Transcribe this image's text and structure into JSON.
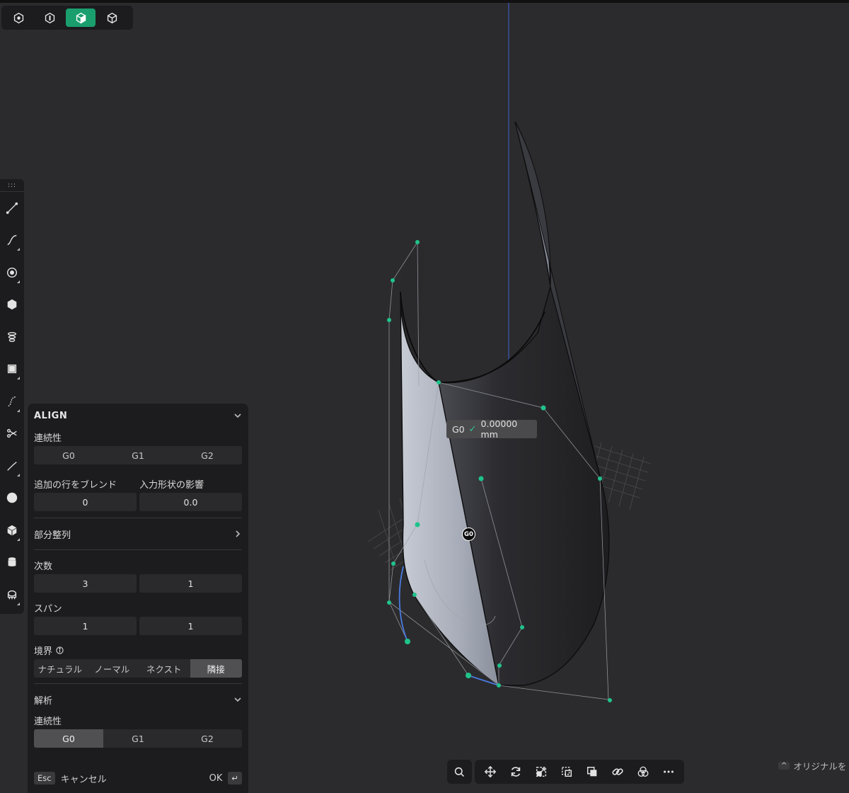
{
  "view_toolbar": {
    "buttons": [
      {
        "icon": "hexagon-dot-icon"
      },
      {
        "icon": "half-cube-icon"
      },
      {
        "icon": "shaded-cube-icon",
        "active": true
      },
      {
        "icon": "wire-cube-icon"
      }
    ]
  },
  "tool_strip": {
    "grip": ":::",
    "tools": [
      {
        "icon": "line-tool-icon"
      },
      {
        "icon": "curve-tool-icon",
        "has_flyout": true
      },
      {
        "icon": "circle-tool-icon",
        "has_flyout": true
      },
      {
        "icon": "polygon-tool-icon"
      },
      {
        "icon": "loft-tool-icon"
      },
      {
        "icon": "surface-frame-icon",
        "has_flyout": true
      },
      {
        "icon": "edit-curve-icon",
        "has_flyout": true
      },
      {
        "icon": "trim-icon"
      },
      {
        "icon": "blend-curve-icon",
        "has_flyout": true
      },
      {
        "icon": "sphere-icon"
      },
      {
        "icon": "solid-cube-icon",
        "has_flyout": true
      },
      {
        "icon": "cylinder-icon"
      },
      {
        "icon": "analysis-icon",
        "has_flyout": true
      }
    ]
  },
  "viewport": {
    "tooltip": {
      "label": "G0",
      "check": "✓",
      "value": "0.00000 mm"
    },
    "marker": "G0"
  },
  "panel": {
    "title": "ALIGN",
    "continuity_label": "連続性",
    "continuity_options": [
      "G0",
      "G1",
      "G2"
    ],
    "blend_rows_label": "追加の行をブレンド",
    "blend_rows_value": "0",
    "input_influence_label": "入力形状の影響",
    "input_influence_value": "0.0",
    "partial_align_label": "部分整列",
    "degree_label": "次数",
    "degree_values": [
      "3",
      "1"
    ],
    "span_label": "スパン",
    "span_values": [
      "1",
      "1"
    ],
    "boundary_label": "境界",
    "boundary_options": [
      "ナチュラル",
      "ノーマル",
      "ネクスト",
      "隣接"
    ],
    "boundary_selected": 3,
    "analysis_label": "解析",
    "analysis_continuity_label": "連続性",
    "analysis_options": [
      "G0",
      "G1",
      "G2"
    ],
    "analysis_selected": 0,
    "esc_key": "Esc",
    "cancel_label": "キャンセル",
    "ok_label": "OK",
    "enter_key": "↵"
  },
  "bottom_toolbar": {
    "search_icon": "search-icon",
    "tools": [
      "move-icon",
      "rotate-icon",
      "scale-icon",
      "select-box-icon",
      "boolean-icon",
      "link-icon",
      "color-icon",
      "more-icon"
    ]
  },
  "hint": {
    "key": "^",
    "text": "オリジナルを"
  },
  "colors": {
    "accent": "#1a9e6e",
    "background": "#2b2b2d",
    "panel": "#1c1c1e",
    "point": "#1fc38a"
  }
}
